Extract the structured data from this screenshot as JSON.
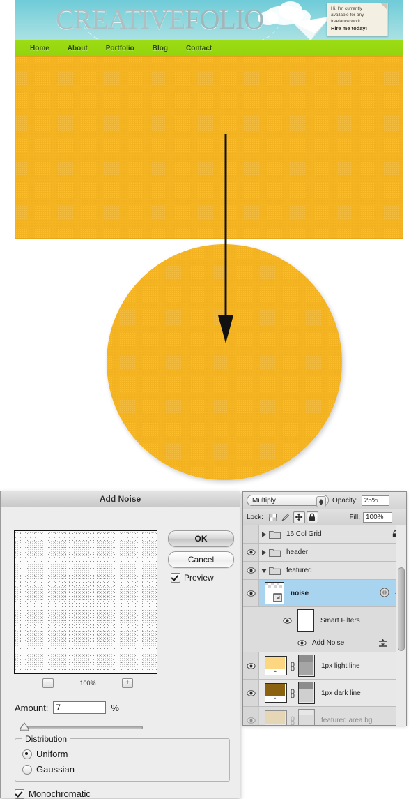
{
  "website": {
    "logo": {
      "part1": "CREATIVE",
      "part2": "FOLIO"
    },
    "sticky_note": {
      "line1": "Hi, I'm currently",
      "line2": "available for any",
      "line3": "freelance work.",
      "cta": "Hire me today!"
    },
    "nav": [
      {
        "label": "Home"
      },
      {
        "label": "About"
      },
      {
        "label": "Portfolio"
      },
      {
        "label": "Blog"
      },
      {
        "label": "Contact"
      }
    ],
    "colors": {
      "featured_orange": "#f5b421",
      "nav_green": "#9cdc14",
      "header_sky": "#8ad6dd"
    }
  },
  "dialog": {
    "title": "Add Noise",
    "ok_label": "OK",
    "cancel_label": "Cancel",
    "preview_label": "Preview",
    "preview_checked": true,
    "zoom_out_label": "−",
    "zoom_in_label": "+",
    "zoom_level": "100%",
    "amount_label": "Amount:",
    "amount_value": "7",
    "amount_unit": "%",
    "distribution_label": "Distribution",
    "uniform_label": "Uniform",
    "gaussian_label": "Gaussian",
    "distribution_selected": "Uniform",
    "monochromatic_label": "Monochromatic",
    "monochromatic_checked": true
  },
  "layers_panel": {
    "blend_mode": "Multiply",
    "opacity_label": "Opacity:",
    "opacity_value": "25%",
    "lock_label": "Lock:",
    "fill_label": "Fill:",
    "fill_value": "100%",
    "lock_buttons": [
      {
        "name": "lock-transparent-pixels",
        "pressed": false
      },
      {
        "name": "lock-image-pixels",
        "pressed": false
      },
      {
        "name": "lock-position",
        "pressed": true
      },
      {
        "name": "lock-all",
        "pressed": true
      }
    ],
    "layers": [
      {
        "name": "16 Col Grid",
        "type": "group",
        "visible": false,
        "expanded": false,
        "locked": true,
        "selected": false
      },
      {
        "name": "header",
        "type": "group",
        "visible": true,
        "expanded": false,
        "locked": false,
        "selected": false
      },
      {
        "name": "featured",
        "type": "group",
        "visible": true,
        "expanded": true,
        "locked": false,
        "selected": false
      },
      {
        "name": "noise",
        "type": "smart-object",
        "visible": true,
        "selected": true
      },
      {
        "name": "Smart Filters",
        "type": "smart-filters",
        "visible": true,
        "selected": false
      },
      {
        "name": "Add Noise",
        "type": "filter",
        "visible": true,
        "selected": false
      },
      {
        "name": "1px light line",
        "type": "layer",
        "visible": true,
        "selected": false
      },
      {
        "name": "1px dark line",
        "type": "layer",
        "visible": true,
        "selected": false
      },
      {
        "name": "featured area bg",
        "type": "layer",
        "visible": true,
        "selected": false,
        "faded": true
      }
    ]
  }
}
